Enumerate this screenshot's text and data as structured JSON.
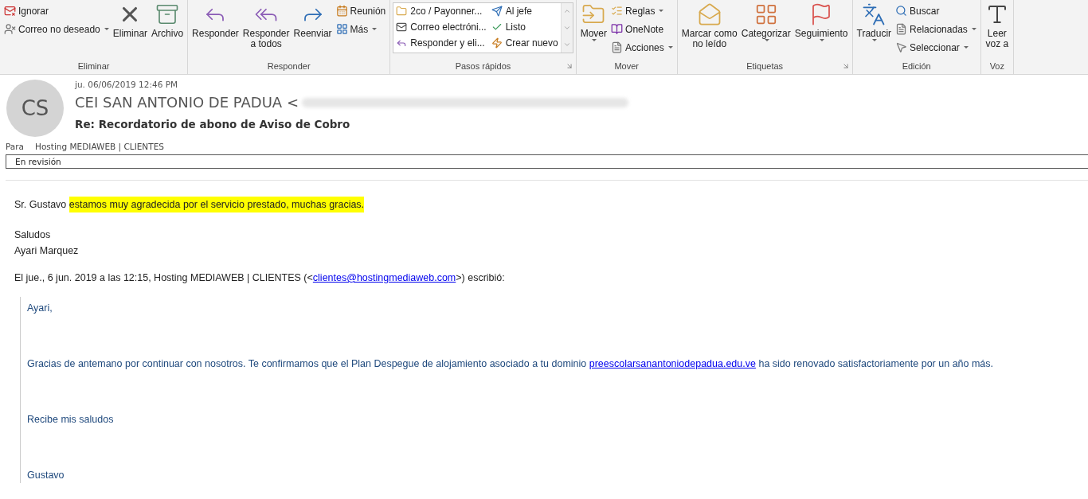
{
  "ribbon": {
    "groups": [
      {
        "label": "Eliminar",
        "items": [
          {
            "kind": "small",
            "label": "Ignorar",
            "dropdown": false
          },
          {
            "kind": "small",
            "label": "Correo no deseado",
            "dropdown": true
          },
          {
            "kind": "large",
            "label": "Eliminar",
            "dropdown": false
          },
          {
            "kind": "large",
            "label": "Archivo",
            "dropdown": false
          }
        ]
      },
      {
        "label": "Responder",
        "items": [
          {
            "kind": "large",
            "label": "Responder",
            "dropdown": false
          },
          {
            "kind": "large",
            "label": "Responder\na todos",
            "dropdown": false
          },
          {
            "kind": "large",
            "label": "Reenviar",
            "dropdown": false
          },
          {
            "kind": "small",
            "label": "Reunión",
            "dropdown": false
          },
          {
            "kind": "small",
            "label": "Más",
            "dropdown": true
          }
        ]
      },
      {
        "label": "Pasos rápidos",
        "launcher": true,
        "gallery": [
          "2co / Payonner...",
          "Correo electróni...",
          "Responder y eli...",
          "Al jefe",
          "Listo",
          "Crear nuevo"
        ]
      },
      {
        "label": "Mover",
        "items": [
          {
            "kind": "large",
            "label": "Mover",
            "dropdown": true
          },
          {
            "kind": "small",
            "label": "Reglas",
            "dropdown": true
          },
          {
            "kind": "small",
            "label": "OneNote",
            "dropdown": false
          },
          {
            "kind": "small",
            "label": "Acciones",
            "dropdown": true
          }
        ]
      },
      {
        "label": "Etiquetas",
        "launcher": true,
        "items": [
          {
            "kind": "large",
            "label": "Marcar como\nno leído",
            "dropdown": false
          },
          {
            "kind": "large",
            "label": "Categorizar",
            "dropdown": true
          },
          {
            "kind": "large",
            "label": "Seguimiento",
            "dropdown": true
          }
        ]
      },
      {
        "label": "Edición",
        "items": [
          {
            "kind": "large",
            "label": "Traducir",
            "dropdown": true
          },
          {
            "kind": "small",
            "label": "Buscar",
            "dropdown": false
          },
          {
            "kind": "small",
            "label": "Relacionadas",
            "dropdown": true
          },
          {
            "kind": "small",
            "label": "Seleccionar",
            "dropdown": true
          }
        ]
      },
      {
        "label": "Voz",
        "items": [
          {
            "kind": "large",
            "label": "Leer\nvoz a",
            "dropdown": false
          }
        ]
      }
    ]
  },
  "message": {
    "avatar": "CS",
    "date": "ju. 06/06/2019 12:46 PM",
    "sender": "CEI SAN ANTONIO DE PADUA <",
    "subject": "Re: Recordatorio de abono de Aviso de Cobro",
    "to_label": "Para",
    "to": "Hosting MEDIAWEB | CLIENTES",
    "info_bar": "En revisión"
  },
  "body": {
    "greeting": [
      {
        "text": "Sr. Gustavo ",
        "highlighted": false
      },
      {
        "text": "estamos muy agradecida por el servicio  prestado, muchas gracias.",
        "highlighted": true
      }
    ],
    "signature": [
      "Saludos",
      "Ayari Marquez"
    ],
    "quote_header": {
      "before": "El jue., 6 jun. 2019 a las 12:15, Hosting MEDIAWEB | CLIENTES (<",
      "link": "clientes@hostingmediaweb.com",
      "after": ">) escribió:"
    },
    "quote": [
      {
        "before": "Ayari,"
      },
      {
        "before": "Gracias de antemano por continuar con nosotros. Te confirmamos que el Plan Despegue de alojamiento asociado a tu dominio ",
        "link": "preescolarsanantoniodepadua.edu.ve",
        "after": " ha sido renovado satisfactoriamente por un año más."
      },
      {
        "before": "Recibe mis saludos"
      },
      {
        "before": "Gustavo"
      }
    ]
  }
}
